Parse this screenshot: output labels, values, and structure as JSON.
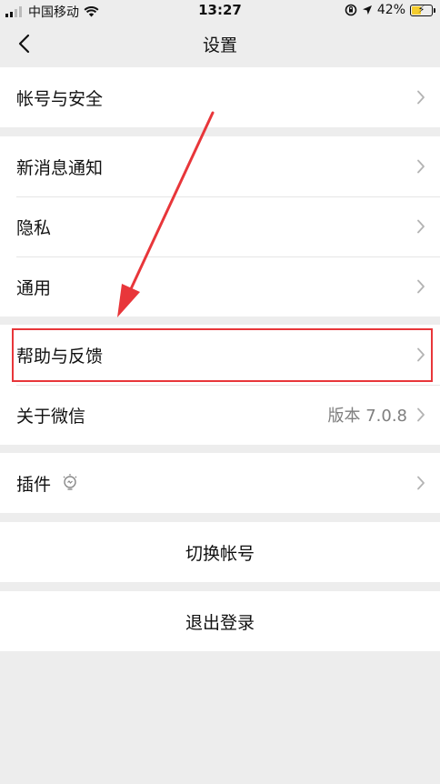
{
  "status_bar": {
    "carrier": "中国移动",
    "time": "13:27",
    "battery": "42%",
    "battery_level": 0.42,
    "icons": [
      "signal-icon",
      "wifi-icon",
      "rotation-lock-icon",
      "location-icon",
      "battery-icon"
    ]
  },
  "nav": {
    "title": "设置",
    "back_icon": "chevron-left-icon"
  },
  "groups": [
    {
      "items": [
        {
          "label": "帐号与安全"
        }
      ]
    },
    {
      "items": [
        {
          "label": "新消息通知"
        },
        {
          "label": "隐私"
        },
        {
          "label": "通用"
        }
      ]
    },
    {
      "items": [
        {
          "label": "帮助与反馈"
        },
        {
          "label": "关于微信",
          "value": "版本 7.0.8"
        }
      ]
    },
    {
      "items": [
        {
          "label": "插件",
          "icon": "lightbulb-icon"
        }
      ]
    }
  ],
  "actions": {
    "switch_account": "切换帐号",
    "logout": "退出登录"
  },
  "colors": {
    "background": "#ededed",
    "cell": "#ffffff",
    "annotation_red": "#e8363a",
    "secondary_text": "#7f7f7f",
    "battery_fill": "#f4cc2d"
  }
}
